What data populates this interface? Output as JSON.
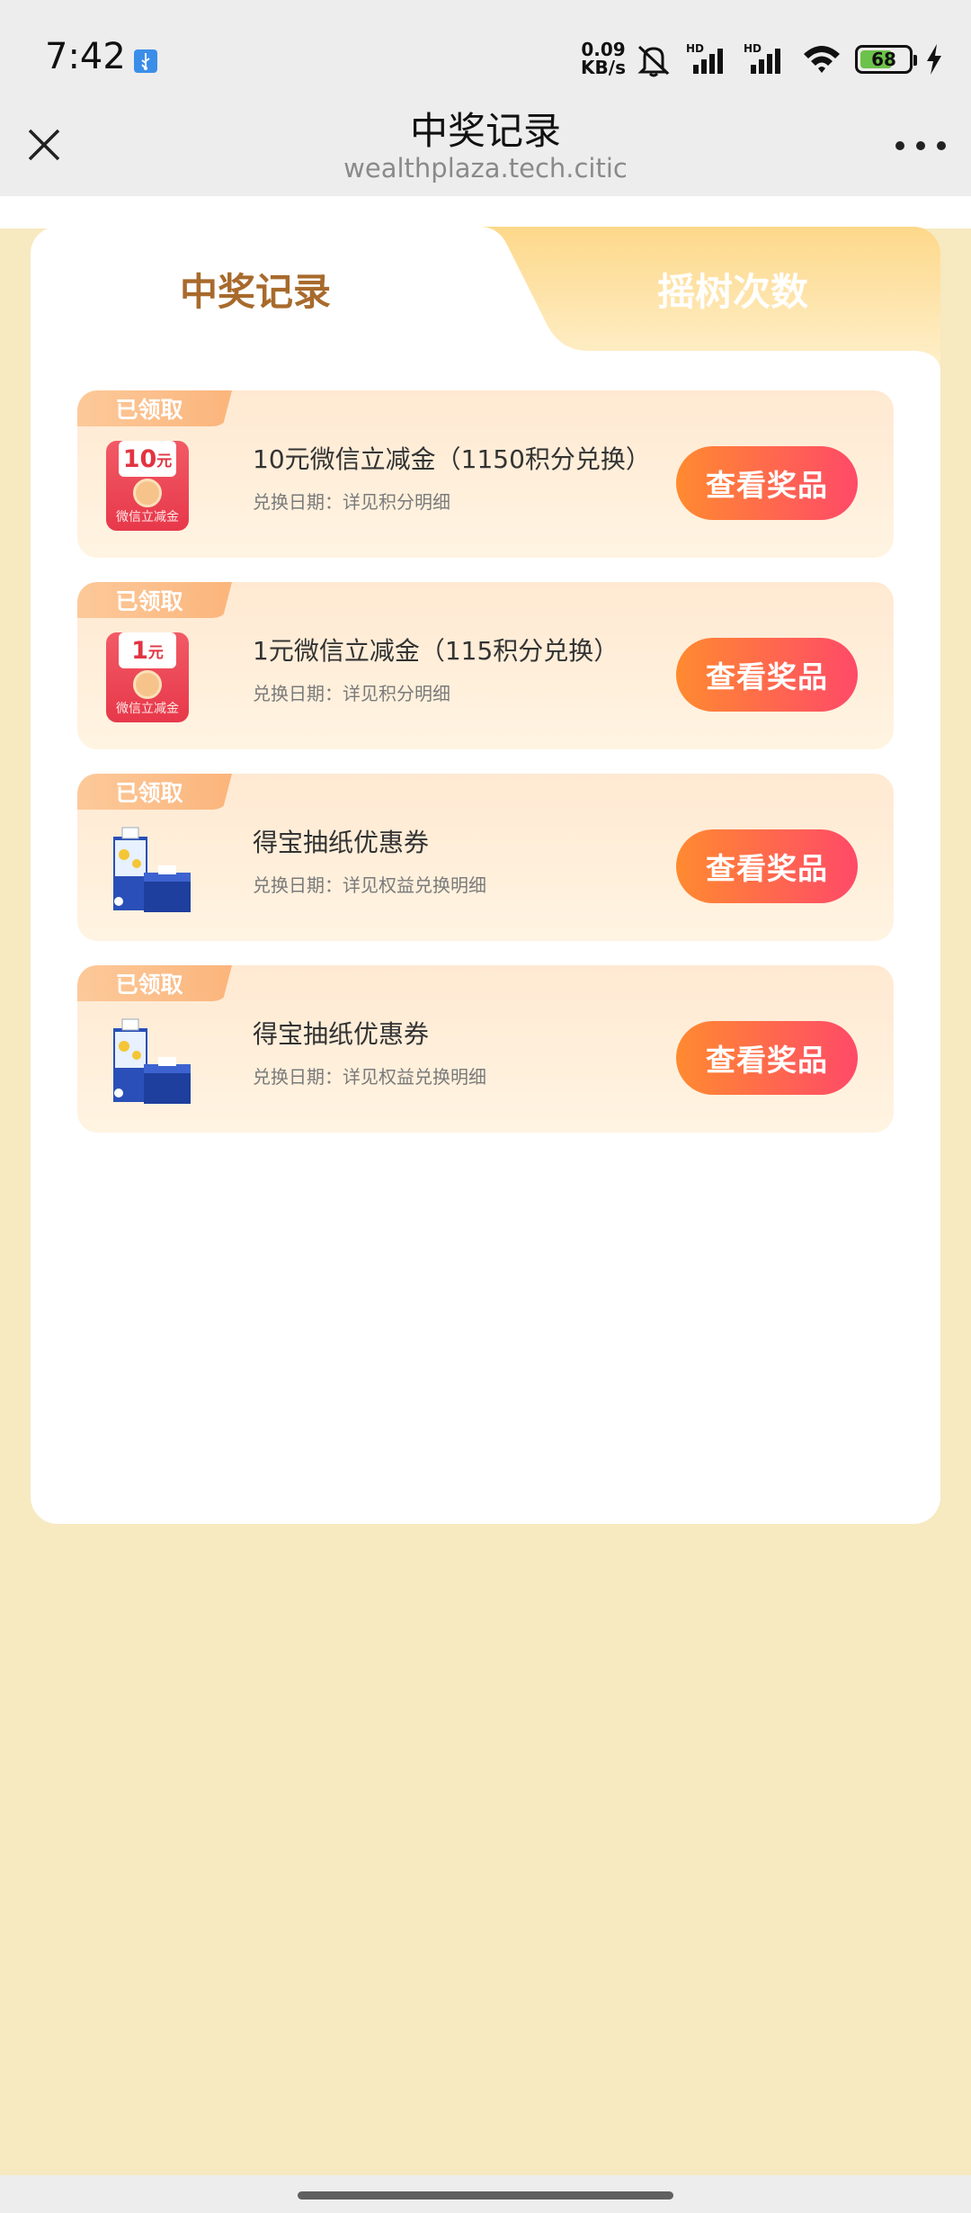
{
  "status_bar": {
    "time": "7:42",
    "net_speed_value": "0.09",
    "net_speed_unit": "KB/s",
    "battery": "68",
    "battery_level": 0.68,
    "icons": [
      "usb-icon",
      "mute-icon",
      "hd-signal-icon",
      "hd-signal-icon",
      "wifi-icon",
      "battery-icon",
      "charging-icon"
    ]
  },
  "header": {
    "title": "中奖记录",
    "subtitle": "wealthplaza.tech.citic",
    "close_icon": "close-icon",
    "more_icon": "more-icon"
  },
  "tabs": [
    {
      "label": "中奖记录",
      "active": true
    },
    {
      "label": "摇树次数",
      "active": false
    }
  ],
  "records": [
    {
      "badge": "已领取",
      "thumb_type": "wechat-coupon",
      "thumb_amount": "10",
      "thumb_unit": "元",
      "thumb_label": "微信立减金",
      "name": "10元微信立减金（1150积分兑换）",
      "date": "兑换日期：详见积分明细",
      "button": "查看奖品"
    },
    {
      "badge": "已领取",
      "thumb_type": "wechat-coupon",
      "thumb_amount": "1",
      "thumb_unit": "元",
      "thumb_label": "微信立减金",
      "name": "1元微信立减金（115积分兑换）",
      "date": "兑换日期：详见积分明细",
      "button": "查看奖品"
    },
    {
      "badge": "已领取",
      "thumb_type": "tissue",
      "name": "得宝抽纸优惠券",
      "date": "兑换日期：详见权益兑换明细",
      "button": "查看奖品"
    },
    {
      "badge": "已领取",
      "thumb_type": "tissue",
      "name": "得宝抽纸优惠券",
      "date": "兑换日期：详见权益兑换明细",
      "button": "查看奖品"
    }
  ],
  "colors": {
    "page_bg": "#f7e9c0",
    "active_tab_text": "#a86a2c",
    "button_gradient_start": "#ff8a30",
    "button_gradient_end": "#ff4a68",
    "badge": "#fbb57c"
  }
}
